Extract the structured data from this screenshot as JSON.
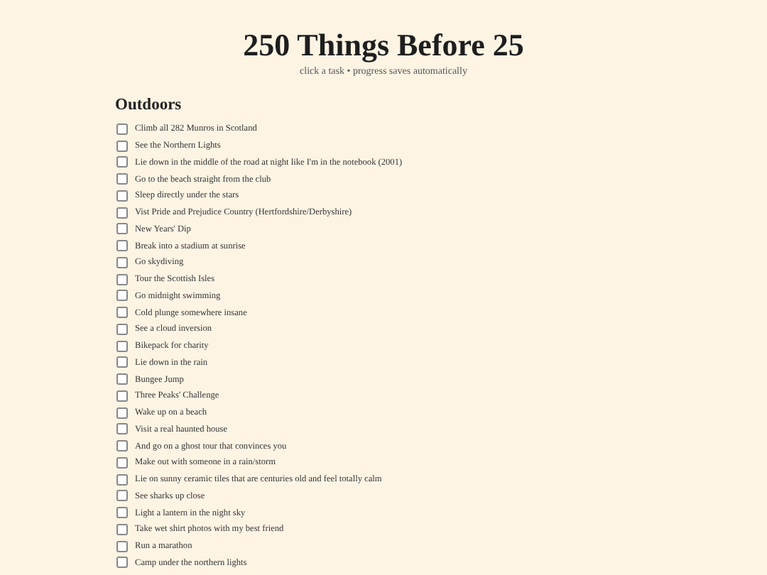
{
  "title": "250 Things Before 25",
  "subtitle": "click a task • progress saves automatically",
  "sections": [
    {
      "heading": "Outdoors",
      "items": [
        {
          "label": "Climb all 282 Munros in Scotland",
          "checked": false
        },
        {
          "label": "See the Northern Lights",
          "checked": false
        },
        {
          "label": "Lie down in the middle of the road at night like I'm in the notebook (2001)",
          "checked": false
        },
        {
          "label": "Go to the beach straight from the club",
          "checked": false
        },
        {
          "label": "Sleep directly under the stars",
          "checked": false
        },
        {
          "label": "Vist Pride and Prejudice Country (Hertfordshire/Derbyshire)",
          "checked": false
        },
        {
          "label": "New Years' Dip",
          "checked": false
        },
        {
          "label": "Break into a stadium at sunrise",
          "checked": false
        },
        {
          "label": "Go skydiving",
          "checked": false
        },
        {
          "label": "Tour the Scottish Isles",
          "checked": false
        },
        {
          "label": "Go midnight swimming",
          "checked": false
        },
        {
          "label": "Cold plunge somewhere insane",
          "checked": false
        },
        {
          "label": "See a cloud inversion",
          "checked": false
        },
        {
          "label": "Bikepack for charity",
          "checked": false
        },
        {
          "label": "Lie down in the rain",
          "checked": false
        },
        {
          "label": "Bungee Jump",
          "checked": false
        },
        {
          "label": "Three Peaks' Challenge",
          "checked": false
        },
        {
          "label": "Wake up on a beach",
          "checked": false
        },
        {
          "label": "Visit a real haunted house",
          "checked": false
        },
        {
          "label": "And go on a ghost tour that convinces you",
          "checked": false
        },
        {
          "label": "Make out with someone in a rain/storm",
          "checked": false
        },
        {
          "label": "Lie on sunny ceramic tiles that are centuries old and feel totally calm",
          "checked": false
        },
        {
          "label": "See sharks up close",
          "checked": false
        },
        {
          "label": "Light a lantern in the night sky",
          "checked": false
        },
        {
          "label": "Take wet shirt photos with my best friend",
          "checked": false
        },
        {
          "label": "Run a marathon",
          "checked": false
        },
        {
          "label": "Camp under the northern lights",
          "checked": false
        }
      ]
    }
  ]
}
